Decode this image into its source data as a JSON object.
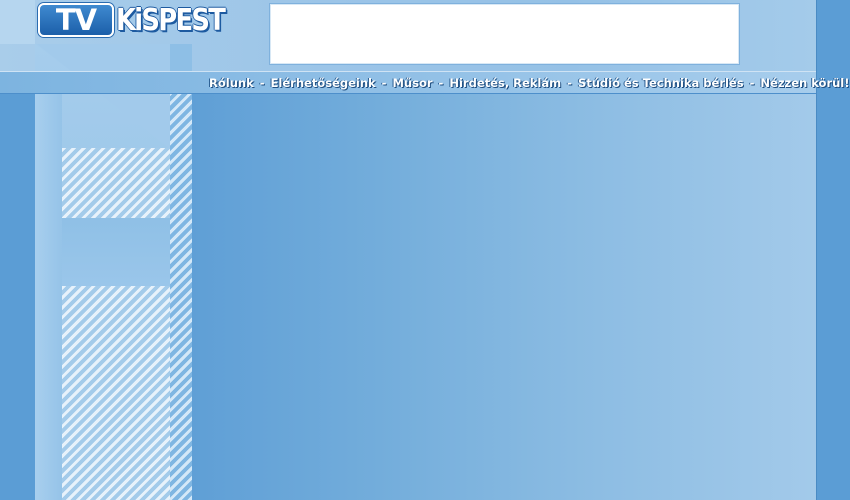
{
  "header": {
    "logo": {
      "tv": "TV",
      "name": "KiSPEST"
    },
    "banner_label": ""
  },
  "nav": {
    "items": [
      {
        "label": "Rólunk"
      },
      {
        "label": "Elérhetőségeink"
      },
      {
        "label": "Műsor"
      },
      {
        "label": "Hirdetés, Reklám"
      },
      {
        "label": "Stúdió és Technika bérlés"
      },
      {
        "label": "Nézzen körül!"
      }
    ],
    "separator": "-"
  },
  "colors": {
    "frame": "#5b9dd5",
    "nav_text": "#ffffff",
    "logo_blue": "#1d5aa0",
    "content_left": "#5f9fd6",
    "content_right": "#a3caea"
  },
  "icons": [
    "logo-tv-icon"
  ]
}
